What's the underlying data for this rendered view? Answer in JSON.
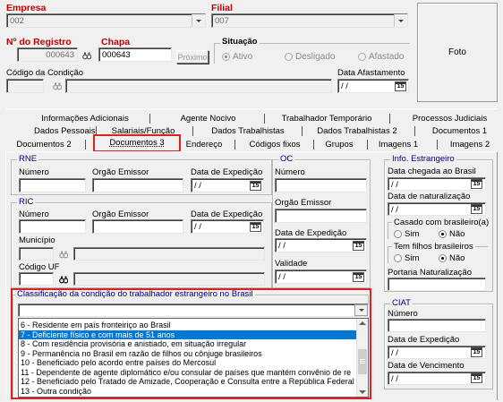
{
  "header": {
    "empresa_label": "Empresa",
    "empresa_value": "002",
    "filial_label": "Filial",
    "filial_value": "007",
    "registro_label": "Nº do Registro",
    "registro_value": "000643",
    "chapa_label": "Chapa",
    "chapa_value": "000643",
    "proximo_button": "Próximo",
    "situacao_label": "Situação",
    "situacao_options": [
      "Ativo",
      "Desligado",
      "Afastado"
    ],
    "situacao_selected": "Ativo",
    "codigo_condicao_label": "Código da Condição",
    "data_afastamento_label": "Data Afastamento",
    "data_afastamento_value": "/ /",
    "foto_label": "Foto"
  },
  "tabs": {
    "row1": [
      "Informações Adicionais",
      "Agente Nocivo",
      "Trabalhador Temporário",
      "Processos Judiciais"
    ],
    "row2": [
      "Dados Pessoais",
      "Salariais/Função",
      "Dados Trabalhistas",
      "Dados Trabalhistas 2",
      "Documentos 1"
    ],
    "row3": [
      "Documentos 2",
      "Documentos 3",
      "Endereço",
      "Códigos fixos",
      "Grupos",
      "Imagens 1",
      "Imagens 2"
    ],
    "active": "Documentos 3"
  },
  "rne": {
    "title": "RNE",
    "numero_label": "Número",
    "orgao_label": "Orgão Emissor",
    "data_label": "Data de Expedição",
    "data_value": "/ /"
  },
  "ric": {
    "title": "RIC",
    "numero_label": "Número",
    "orgao_label": "Orgão Emissor",
    "data_label": "Data de Expedição",
    "data_value": "/ /",
    "municipio_label": "Município",
    "codigo_uf_label": "Código UF"
  },
  "oc": {
    "title": "OC",
    "numero_label": "Número",
    "orgao_label": "Orgão Emissor",
    "data_label": "Data de Expedição",
    "data_value": "/ /",
    "validade_label": "Validade",
    "validade_value": "/ /"
  },
  "estrangeiro": {
    "title": "Info. Estrangeiro",
    "chegada_label": "Data chegada ao Brasil",
    "chegada_value": "/ /",
    "naturalizacao_label": "Data de naturalização",
    "naturalizacao_value": "/ /",
    "casado_label": "Casado com brasileiro(a)",
    "casado_options": [
      "Sim",
      "Não"
    ],
    "casado_selected": "Não",
    "filhos_label": "Tem filhos brasileiros",
    "filhos_options": [
      "Sim",
      "Não"
    ],
    "filhos_selected": "Não",
    "portaria_label": "Portaria Naturalização"
  },
  "ciat": {
    "title": "CIAT",
    "numero_label": "Número",
    "data_expedicao_label": "Data de Expedição",
    "data_expedicao_value": "/ /",
    "data_vencimento_label": "Data de Vencimento",
    "data_vencimento_value": "/ /"
  },
  "classificacao": {
    "title": "Classificação da condição do trabalhador estrangeiro no Brasil",
    "selected_value": "",
    "options": [
      "6 - Residente em país fronteiriço ao Brasil",
      "7 - Deficiente físico e com mais de 51 anos",
      "8 - Com residência provisória e anistiado, em situação irregular",
      "9 - Permanência no Brasil em razão de filhos ou cônjuge brasileiros",
      "10 - Beneficiado pelo acordo entre países do Mercosul",
      "11 - Dependente de agente diplomático e/ou consular de países que mantém convênio de re",
      "12 - Beneficiado pelo Tratado de Amizade, Cooperação e Consulta entre a República Federal",
      "13 - Outra condição"
    ],
    "highlighted_index": 1
  }
}
